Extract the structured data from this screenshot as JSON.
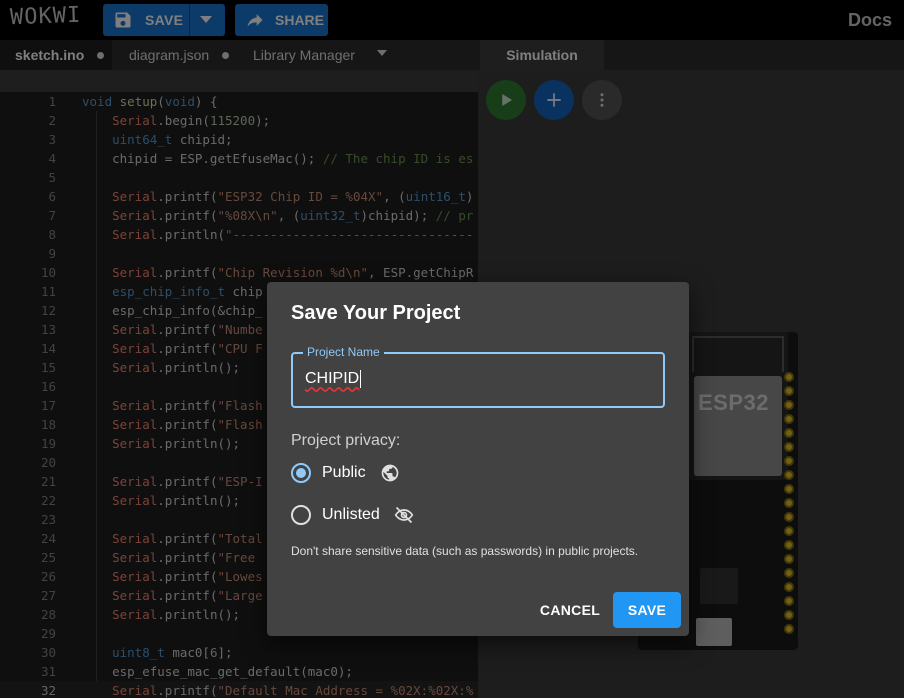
{
  "header": {
    "logo": "WOKWI",
    "save_label": "SAVE",
    "share_label": "SHARE",
    "docs_label": "Docs"
  },
  "tabs": [
    {
      "label": "sketch.ino",
      "modified": true
    },
    {
      "label": "diagram.json",
      "modified": true
    },
    {
      "label": "Library Manager"
    }
  ],
  "simulation": {
    "tab_label": "Simulation",
    "board_label": "ESP32"
  },
  "editor": {
    "current_line": 32,
    "lines": [
      {
        "n": "1",
        "text": "void setup(void) {"
      },
      {
        "n": "2",
        "text": "    Serial.begin(115200);"
      },
      {
        "n": "3",
        "text": "    uint64_t chipid;"
      },
      {
        "n": "4",
        "text": "    chipid = ESP.getEfuseMac(); // The chip ID is es"
      },
      {
        "n": "5",
        "text": ""
      },
      {
        "n": "6",
        "text": "    Serial.printf(\"ESP32 Chip ID = %04X\", (uint16_t)"
      },
      {
        "n": "7",
        "text": "    Serial.printf(\"%08X\\n\", (uint32_t)chipid); // pr"
      },
      {
        "n": "8",
        "text": "    Serial.println(\"--------------------------------"
      },
      {
        "n": "9",
        "text": ""
      },
      {
        "n": "10",
        "text": "    Serial.printf(\"Chip Revision %d\\n\", ESP.getChipR"
      },
      {
        "n": "11",
        "text": "    esp_chip_info_t chip"
      },
      {
        "n": "12",
        "text": "    esp_chip_info(&chip_"
      },
      {
        "n": "13",
        "text": "    Serial.printf(\"Numbe"
      },
      {
        "n": "14",
        "text": "    Serial.printf(\"CPU F"
      },
      {
        "n": "15",
        "text": "    Serial.println();"
      },
      {
        "n": "16",
        "text": ""
      },
      {
        "n": "17",
        "text": "    Serial.printf(\"Flash"
      },
      {
        "n": "18",
        "text": "    Serial.printf(\"Flash"
      },
      {
        "n": "19",
        "text": "    Serial.println();"
      },
      {
        "n": "20",
        "text": ""
      },
      {
        "n": "21",
        "text": "    Serial.printf(\"ESP-I"
      },
      {
        "n": "22",
        "text": "    Serial.println();"
      },
      {
        "n": "23",
        "text": ""
      },
      {
        "n": "24",
        "text": "    Serial.printf(\"Total"
      },
      {
        "n": "25",
        "text": "    Serial.printf(\"Free "
      },
      {
        "n": "26",
        "text": "    Serial.printf(\"Lowes"
      },
      {
        "n": "27",
        "text": "    Serial.printf(\"Large"
      },
      {
        "n": "28",
        "text": "    Serial.println();"
      },
      {
        "n": "29",
        "text": ""
      },
      {
        "n": "30",
        "text": "    uint8_t mac0[6];"
      },
      {
        "n": "31",
        "text": "    esp_efuse_mac_get_default(mac0);"
      },
      {
        "n": "32",
        "text": "    Serial.printf(\"Default Mac Address = %02X:%02X:%"
      }
    ]
  },
  "dialog": {
    "title": "Save Your Project",
    "field_label": "Project Name",
    "field_value": "CHIPID",
    "privacy_label": "Project privacy:",
    "option_public": "Public",
    "option_unlisted": "Unlisted",
    "selected": "Public",
    "note": "Don't share sensitive data (such as passwords) in public projects.",
    "cancel_label": "CANCEL",
    "save_label": "SAVE"
  },
  "colors": {
    "accent": "#1976d2",
    "save_button": "#2196f3",
    "focus": "#90caf9",
    "keyword": "#569cd6",
    "function": "#dcdcaa",
    "string": "#ce9178",
    "builtin": "#f48771",
    "comment": "#6a9955",
    "number": "#b5cea8"
  }
}
